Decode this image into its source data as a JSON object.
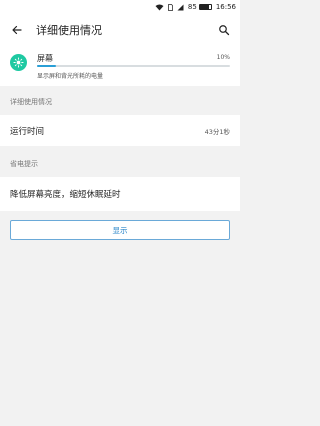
{
  "status_bar": {
    "battery_level": "85",
    "time": "16:56",
    "battery_fraction": 0.85
  },
  "header": {
    "title": "详细使用情况"
  },
  "usage": {
    "name": "屏幕",
    "percent": "10%",
    "percent_value": 0.1,
    "description": "显示屏和背光所耗的电量",
    "icon_color": "#1ec9a2"
  },
  "details": {
    "section_label": "详细使用情况",
    "run_time_label": "运行时间",
    "run_time_value": "43分1秒"
  },
  "tips": {
    "section_label": "省电提示",
    "tip_text": "降低屏幕亮度，缩短休眠延时",
    "button_label": "显示"
  },
  "colors": {
    "accent": "#2a86c9",
    "bar": "#2a9fd6"
  }
}
